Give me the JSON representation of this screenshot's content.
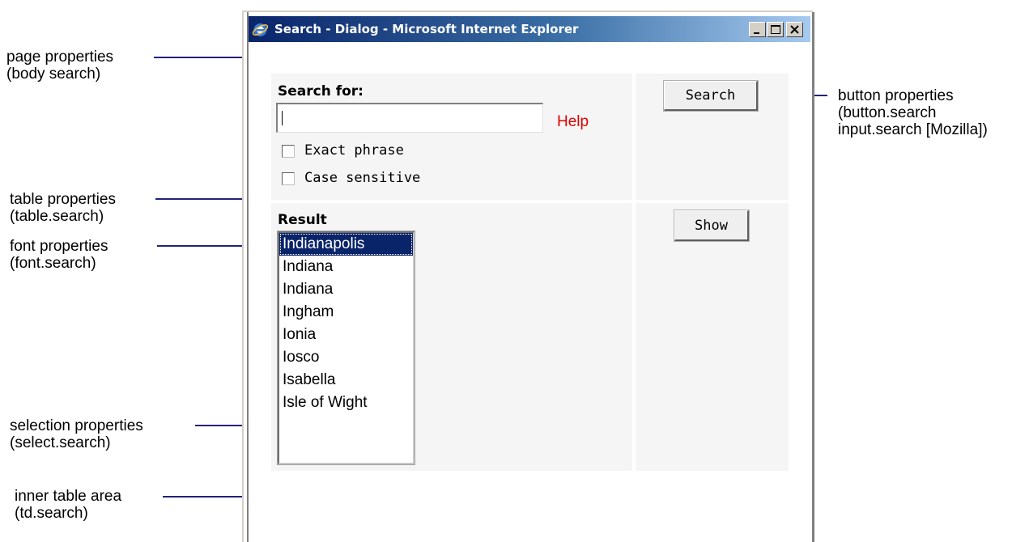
{
  "window": {
    "title": "Search - Dialog - Microsoft Internet Explorer",
    "controls": {
      "minimize_icon": "minimize-icon",
      "maximize_icon": "maximize-icon",
      "close_icon": "close-icon"
    }
  },
  "form": {
    "search_label": "Search for:",
    "search_value": "",
    "help_link": "Help",
    "checkboxes": [
      {
        "label": "Exact phrase",
        "checked": false
      },
      {
        "label": "Case sensitive",
        "checked": false
      }
    ],
    "search_button": "Search"
  },
  "result": {
    "label": "Result",
    "options": [
      "Indianapolis",
      "Indiana",
      "Indiana",
      "Ingham",
      "Ionia",
      "Iosco",
      "Isabella",
      "Isle of Wight"
    ],
    "selected_index": 0,
    "show_button": "Show"
  },
  "annotations": {
    "page": [
      "page properties",
      "(body search)"
    ],
    "table": [
      "table properties",
      "(table.search)"
    ],
    "font": [
      "font properties",
      "(font.search)"
    ],
    "selection": [
      "selection properties",
      "(select.search)"
    ],
    "inner": [
      "inner table area",
      "(td.search)"
    ],
    "button": [
      "button properties",
      "(button.search",
      "input.search [Mozilla])"
    ]
  },
  "colors": {
    "titlebar_start": "#0a246a",
    "titlebar_end": "#a6caf0",
    "help_link": "#e00000",
    "selection_bg": "#0a246a",
    "annotation_line": "#22227a",
    "cell_bg": "#f5f5f5"
  }
}
